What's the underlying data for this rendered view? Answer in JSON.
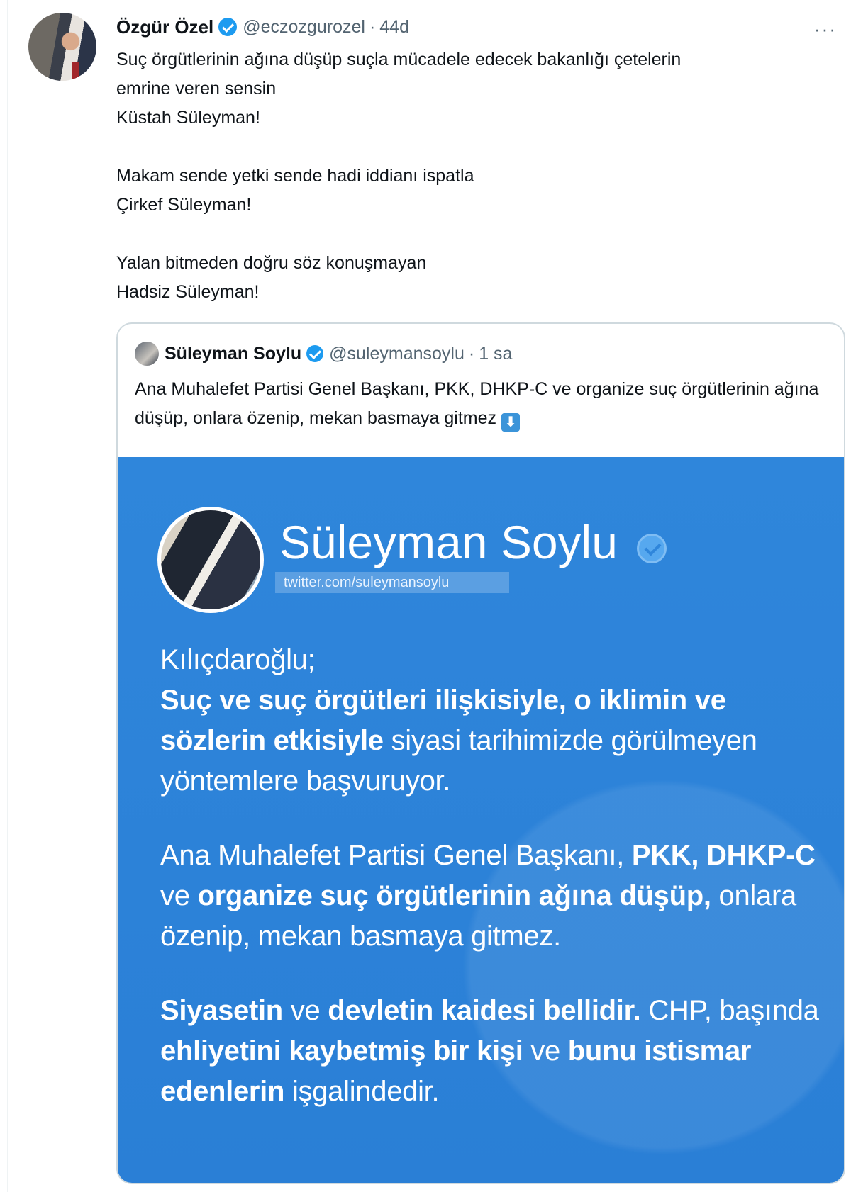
{
  "tweet": {
    "author_name": "Özgür Özel",
    "author_handle": "@eczozgurozel",
    "separator": "·",
    "time": "44d",
    "more": "···",
    "paragraphs": [
      "Suç örgütlerinin ağına düşüp suçla mücadele edecek bakanlığı çetelerin\nemrine veren sensin\nKüstah Süleyman!",
      "Makam sende yetki sende hadi iddianı ispatla\nÇirkef Süleyman!",
      "Yalan bitmeden doğru söz konuşmayan\nHadsiz Süleyman!"
    ]
  },
  "quote": {
    "author_name": "Süleyman Soylu",
    "author_handle": "@suleymansoylu",
    "separator": "·",
    "time": "1 sa",
    "text": "Ana Muhalefet Partisi Genel Başkanı, PKK, DHKP-C ve organize suç örgütlerinin ağına düşüp, onlara özenip, mekan basmaya gitmez",
    "emoji": "⬇",
    "media": {
      "name": "Süleyman Soylu",
      "url": "twitter.com/suleymansoylu",
      "p1": [
        {
          "t": "Kılıçdaroğlu;",
          "b": false
        },
        {
          "t": "Suç ve suç örgütleri ilişkisiyle, o iklimin ve sözlerin etkisiyle",
          "b": true
        },
        {
          "t": " siyasi tarihimizde görülmeyen yöntemlere başvuruyor.",
          "b": false
        }
      ],
      "p2": [
        {
          "t": "Ana Muhalefet Partisi Genel Başkanı, ",
          "b": false
        },
        {
          "t": "PKK, DHKP-C",
          "b": true
        },
        {
          "t": " ve ",
          "b": false
        },
        {
          "t": "organize suç örgütlerinin ağına düşüp,",
          "b": true
        },
        {
          "t": " onlara özenip, mekan basmaya gitmez.",
          "b": false
        }
      ],
      "p3": [
        {
          "t": "Siyasetin",
          "b": true
        },
        {
          "t": " ve ",
          "b": false
        },
        {
          "t": "devletin kaidesi bellidir.",
          "b": true
        },
        {
          "t": " CHP, başında ",
          "b": false
        },
        {
          "t": "ehliyetini kaybetmiş bir kişi",
          "b": true
        },
        {
          "t": " ve ",
          "b": false
        },
        {
          "t": "bunu istismar edenlerin",
          "b": true
        },
        {
          "t": " işgalindedir.",
          "b": false
        }
      ]
    }
  }
}
